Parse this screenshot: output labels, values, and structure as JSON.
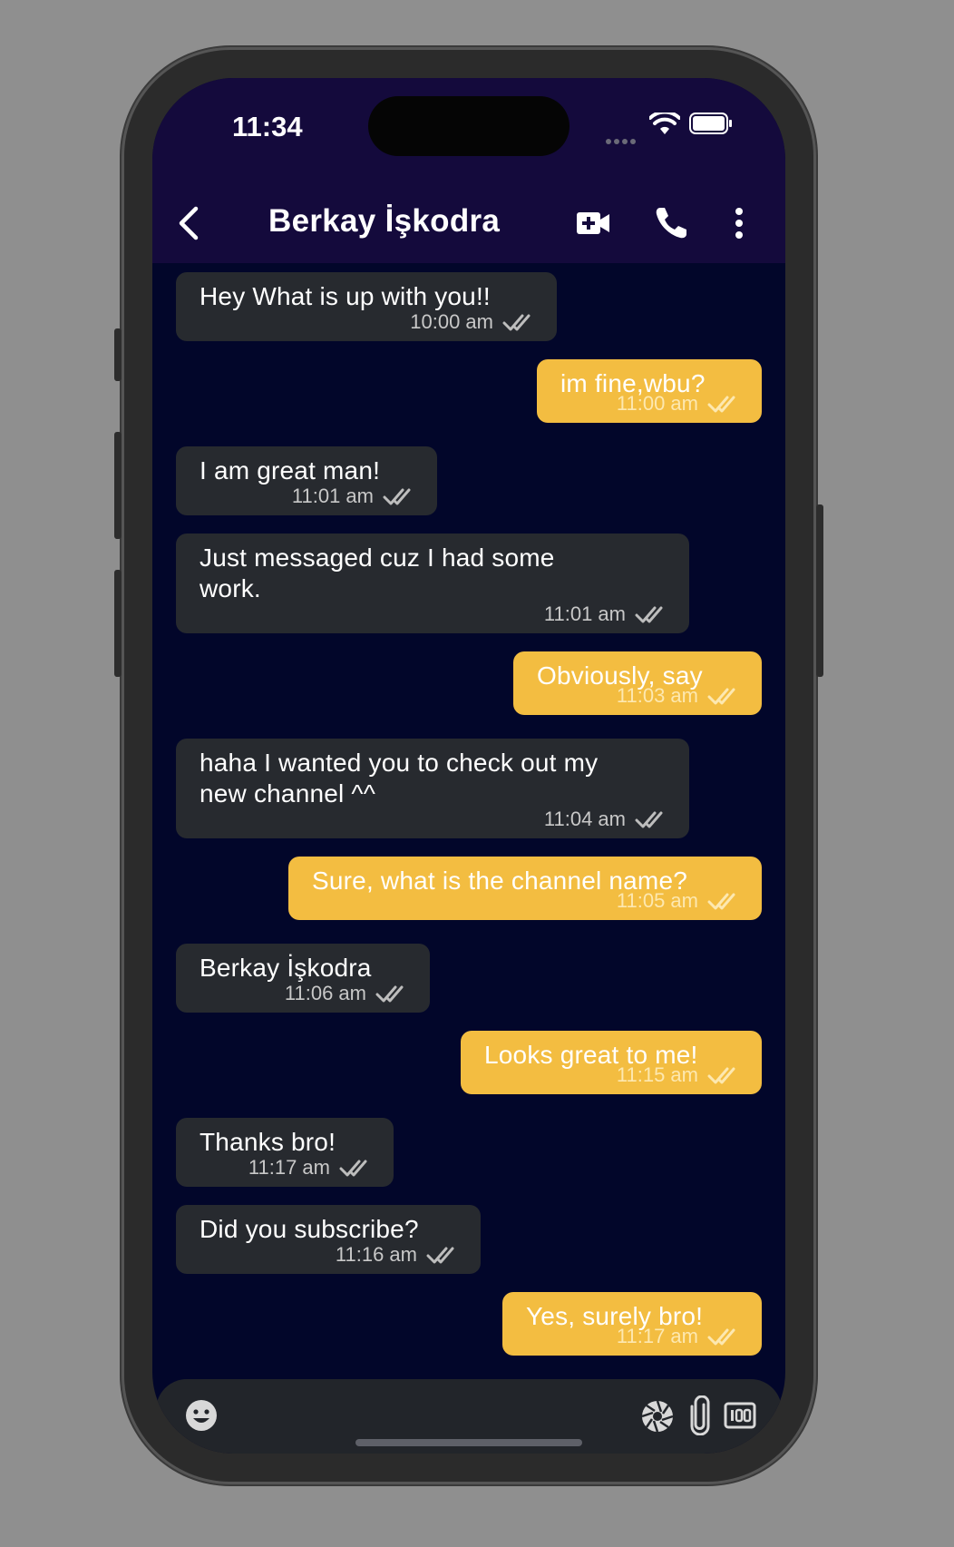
{
  "status_bar": {
    "time": "11:34"
  },
  "header": {
    "title": "Berkay İşkodra"
  },
  "colors": {
    "header_bg": "#140a3c",
    "chat_bg": "#02062a",
    "incoming_bubble": "#272a2f",
    "outgoing_bubble": "#f3bd41"
  },
  "messages": [
    {
      "direction": "in",
      "text": "Hey What is up with you!!",
      "time": "10:00 am",
      "status_icon": "double-check-icon"
    },
    {
      "direction": "out",
      "text": "im fine,wbu?",
      "time": "11:00 am",
      "status_icon": "double-check-icon"
    },
    {
      "direction": "in",
      "text": "I am great man!",
      "time": "11:01 am",
      "status_icon": "double-check-icon"
    },
    {
      "direction": "in",
      "text": "Just messaged cuz I had some\nwork.",
      "time": "11:01 am",
      "status_icon": "double-check-icon"
    },
    {
      "direction": "out",
      "text": "Obviously, say",
      "time": "11:03 am",
      "status_icon": "double-check-icon"
    },
    {
      "direction": "in",
      "text": "haha I wanted you to check out my\nnew channel ^^",
      "time": "11:04 am",
      "status_icon": "double-check-icon"
    },
    {
      "direction": "out",
      "text": "Sure, what is the channel name?",
      "time": "11:05 am",
      "status_icon": "double-check-icon"
    },
    {
      "direction": "in",
      "text": "Berkay İşkodra",
      "time": "11:06 am",
      "status_icon": "double-check-icon"
    },
    {
      "direction": "out",
      "text": "Looks great to me!",
      "time": "11:15 am",
      "status_icon": "double-check-icon"
    },
    {
      "direction": "in",
      "text": "Thanks bro!",
      "time": "11:17 am",
      "status_icon": "double-check-icon"
    },
    {
      "direction": "in",
      "text": "Did you subscribe?",
      "time": "11:16 am",
      "status_icon": "double-check-icon"
    },
    {
      "direction": "out",
      "text": "Yes, surely bro!",
      "time": "11:17 am",
      "status_icon": "double-check-icon"
    }
  ],
  "input_bar": {
    "icons": [
      "emoji-icon",
      "camera-shutter-icon",
      "paperclip-icon",
      "gif-icon"
    ]
  }
}
